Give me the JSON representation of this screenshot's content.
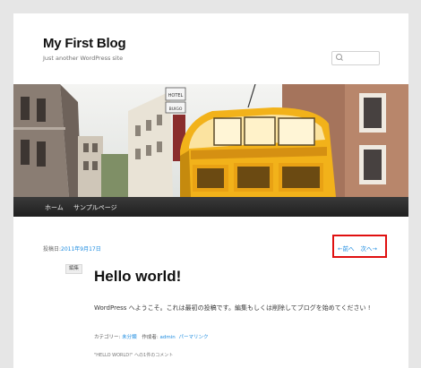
{
  "header": {
    "site_title": "My First Blog",
    "site_description": "Just another WordPress site",
    "search_placeholder": ""
  },
  "banner": {
    "sign_lines": [
      "HOTEL",
      "BUIGO"
    ]
  },
  "nav": {
    "items": [
      {
        "label": "ホーム"
      },
      {
        "label": "サンプルページ"
      }
    ]
  },
  "post_navigation": {
    "date_label": "投稿日:",
    "date": "2011年9月17日",
    "previous": "←前へ",
    "next": "次へ→"
  },
  "post": {
    "edit_label": "編集",
    "title": "Hello world!",
    "body": "WordPress へようこそ。これは最初の投稿です。編集もしくは削除してブログを始めてください !",
    "meta": {
      "category_label": "カテゴリー:",
      "category": "未分類",
      "author_label": "作成者:",
      "author": "admin",
      "permalink": "パーマリンク"
    },
    "comments_note": "\"HELLO WORLD!\" への1件のコメント"
  },
  "colors": {
    "link": "#1b8be0",
    "highlight_box": "#e01010",
    "tram_yellow": "#f2b21a"
  }
}
